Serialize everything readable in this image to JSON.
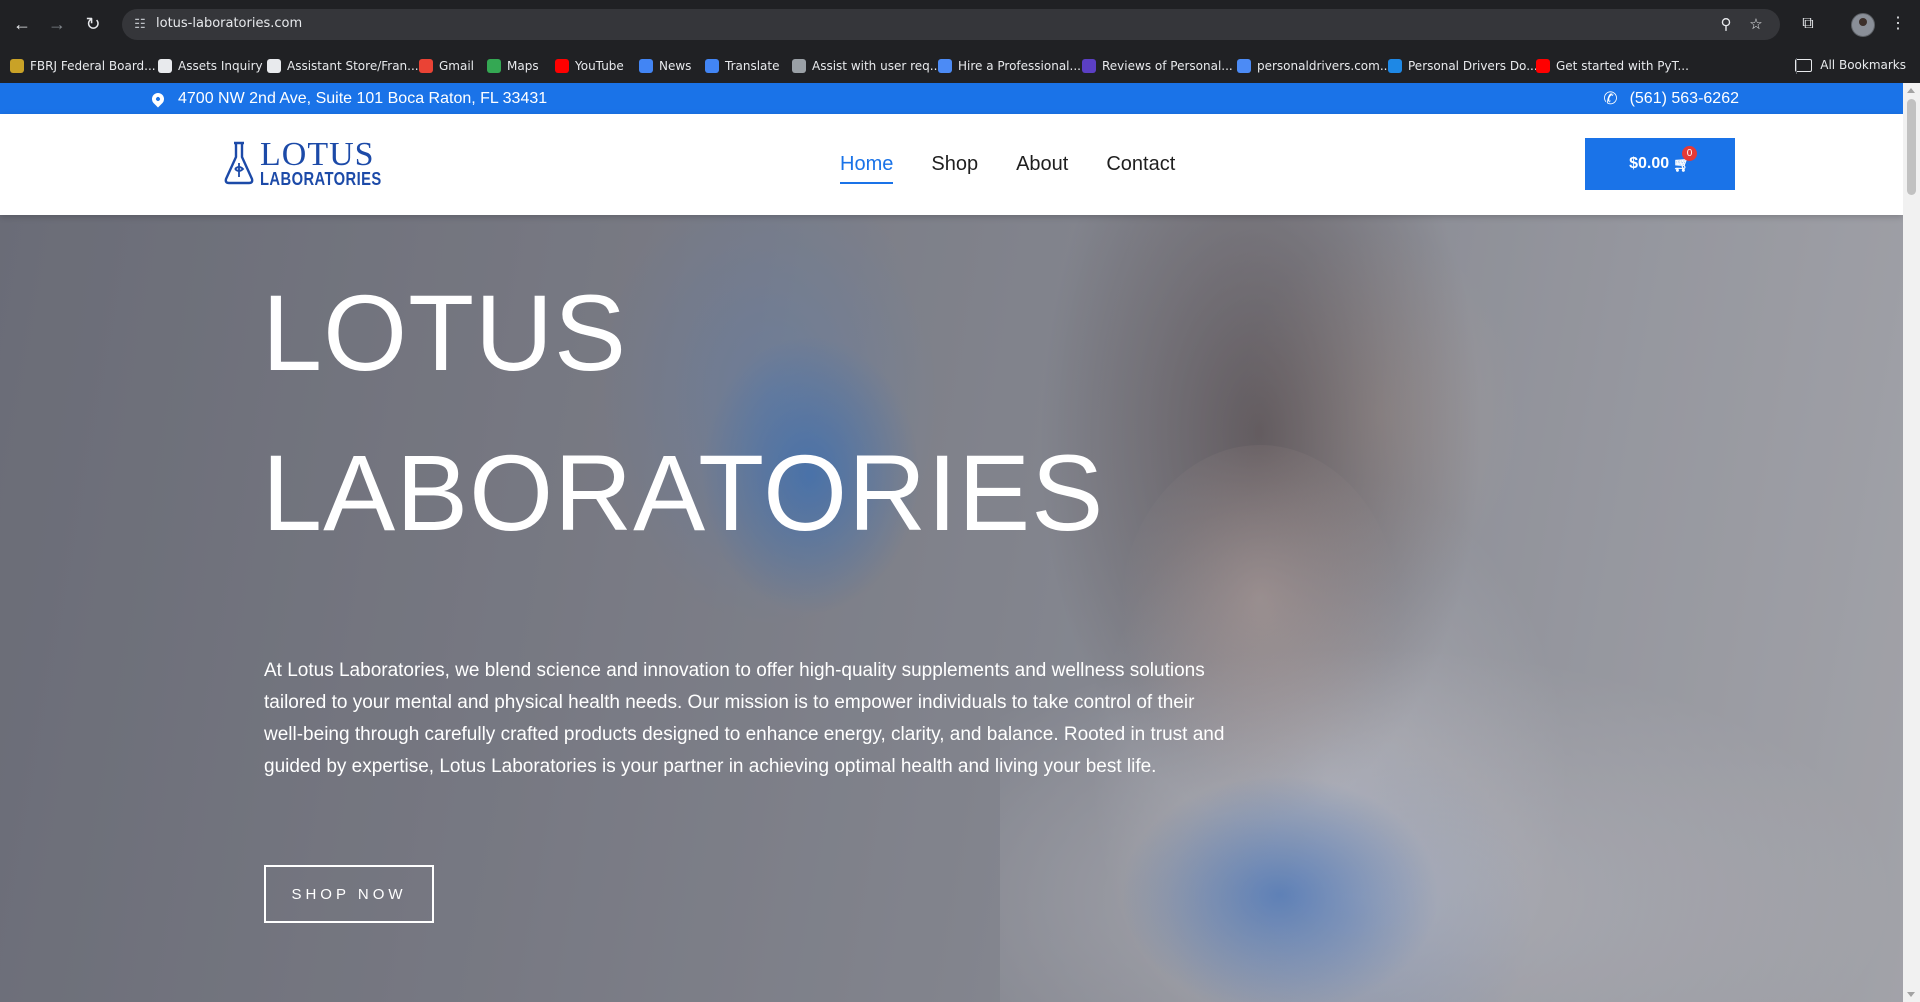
{
  "browser": {
    "url": "lotus-laboratories.com",
    "bookmarks": [
      {
        "label": "FBRJ Federal Board...",
        "icon": "doc-icon",
        "color": "#c9a227"
      },
      {
        "label": "Assets Inquiry",
        "icon": "globe-icon",
        "color": "#e8eaed"
      },
      {
        "label": "Assistant Store/Fran...",
        "icon": "info-icon",
        "color": "#e8eaed"
      },
      {
        "label": "Gmail",
        "icon": "gmail-icon",
        "color": "#ea4335"
      },
      {
        "label": "Maps",
        "icon": "maps-icon",
        "color": "#34a853"
      },
      {
        "label": "YouTube",
        "icon": "youtube-icon",
        "color": "#ff0000"
      },
      {
        "label": "News",
        "icon": "news-icon",
        "color": "#4285f4"
      },
      {
        "label": "Translate",
        "icon": "translate-icon",
        "color": "#4285f4"
      },
      {
        "label": "Assist with user req...",
        "icon": "openai-icon",
        "color": "#9aa0a6"
      },
      {
        "label": "Hire a Professional...",
        "icon": "globe-icon",
        "color": "#4c8bf5"
      },
      {
        "label": "Reviews of Personal...",
        "icon": "star-icon",
        "color": "#5b3fc4"
      },
      {
        "label": "personaldrivers.com...",
        "icon": "globe-icon",
        "color": "#4c8bf5"
      },
      {
        "label": "Personal Drivers Do...",
        "icon": "cloud-icon",
        "color": "#1e88e5"
      },
      {
        "label": "Get started with PyT...",
        "icon": "youtube-icon",
        "color": "#ff0000"
      }
    ],
    "all_bookmarks": "All Bookmarks"
  },
  "topbar": {
    "address": "4700 NW 2nd Ave, Suite 101 Boca Raton, FL 33431",
    "phone": "(561) 563-6262"
  },
  "logo": {
    "main": "LOTUS",
    "sub": "LABORATORIES"
  },
  "nav": [
    {
      "label": "Home",
      "active": true
    },
    {
      "label": "Shop",
      "active": false
    },
    {
      "label": "About",
      "active": false
    },
    {
      "label": "Contact",
      "active": false
    }
  ],
  "cart": {
    "total": "$0.00",
    "count": "0"
  },
  "hero": {
    "title_line1": "LOTUS",
    "title_line2": "LABORATORIES",
    "description": "At Lotus Laboratories, we blend science and innovation to offer high-quality supplements and wellness solutions tailored to your mental and physical health needs. Our mission is to empower individuals to take control of their well-being through carefully crafted products designed to enhance energy, clarity, and balance. Rooted in trust and guided by expertise, Lotus Laboratories is your partner in achieving optimal health and living your best life.",
    "cta": "SHOP NOW"
  },
  "colors": {
    "accent": "#1a73e8",
    "logo": "#1c4aa8",
    "badge": "#e53935"
  }
}
